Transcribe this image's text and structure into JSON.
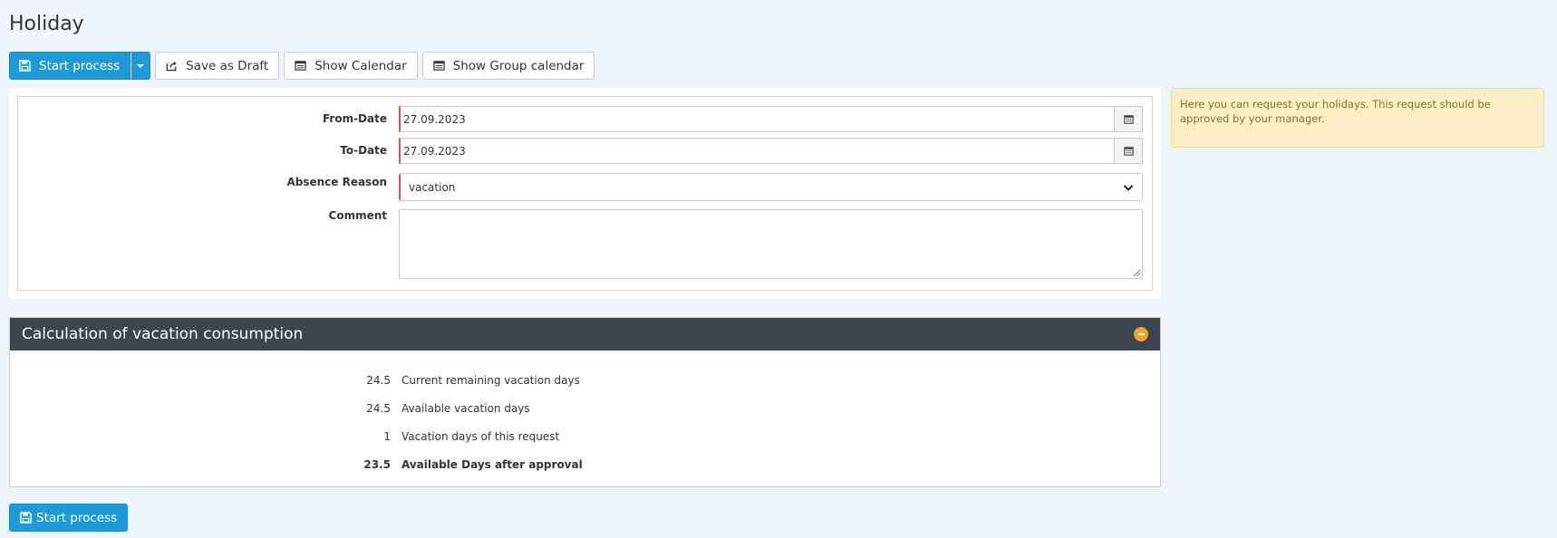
{
  "page": {
    "title": "Holiday"
  },
  "toolbar": {
    "start_process": "Start process",
    "save_draft": "Save as Draft",
    "show_calendar": "Show Calendar",
    "show_group_calendar": "Show Group calendar"
  },
  "form": {
    "from_date": {
      "label": "From-Date",
      "value": "27.09.2023"
    },
    "to_date": {
      "label": "To-Date",
      "value": "27.09.2023"
    },
    "absence_reason": {
      "label": "Absence Reason",
      "value": "vacation"
    },
    "comment": {
      "label": "Comment",
      "value": ""
    }
  },
  "info": {
    "text": "Here you can request your holidays. This request should be approved by your manager."
  },
  "calculation": {
    "title": "Calculation of vacation consumption",
    "rows": [
      {
        "value": "24.5",
        "label": "Current remaining vacation days"
      },
      {
        "value": "24.5",
        "label": "Available vacation days"
      },
      {
        "value": "1",
        "label": "Vacation days of this request"
      },
      {
        "value": "23.5",
        "label": "Available Days after approval"
      }
    ]
  },
  "footer": {
    "start_process": "Start process"
  },
  "colors": {
    "primary": "#1e9bd7",
    "header_dark": "#3d464f",
    "accent_orange": "#f0a22c",
    "required_marker": "#d9534f",
    "info_bg": "#fcefc7"
  }
}
